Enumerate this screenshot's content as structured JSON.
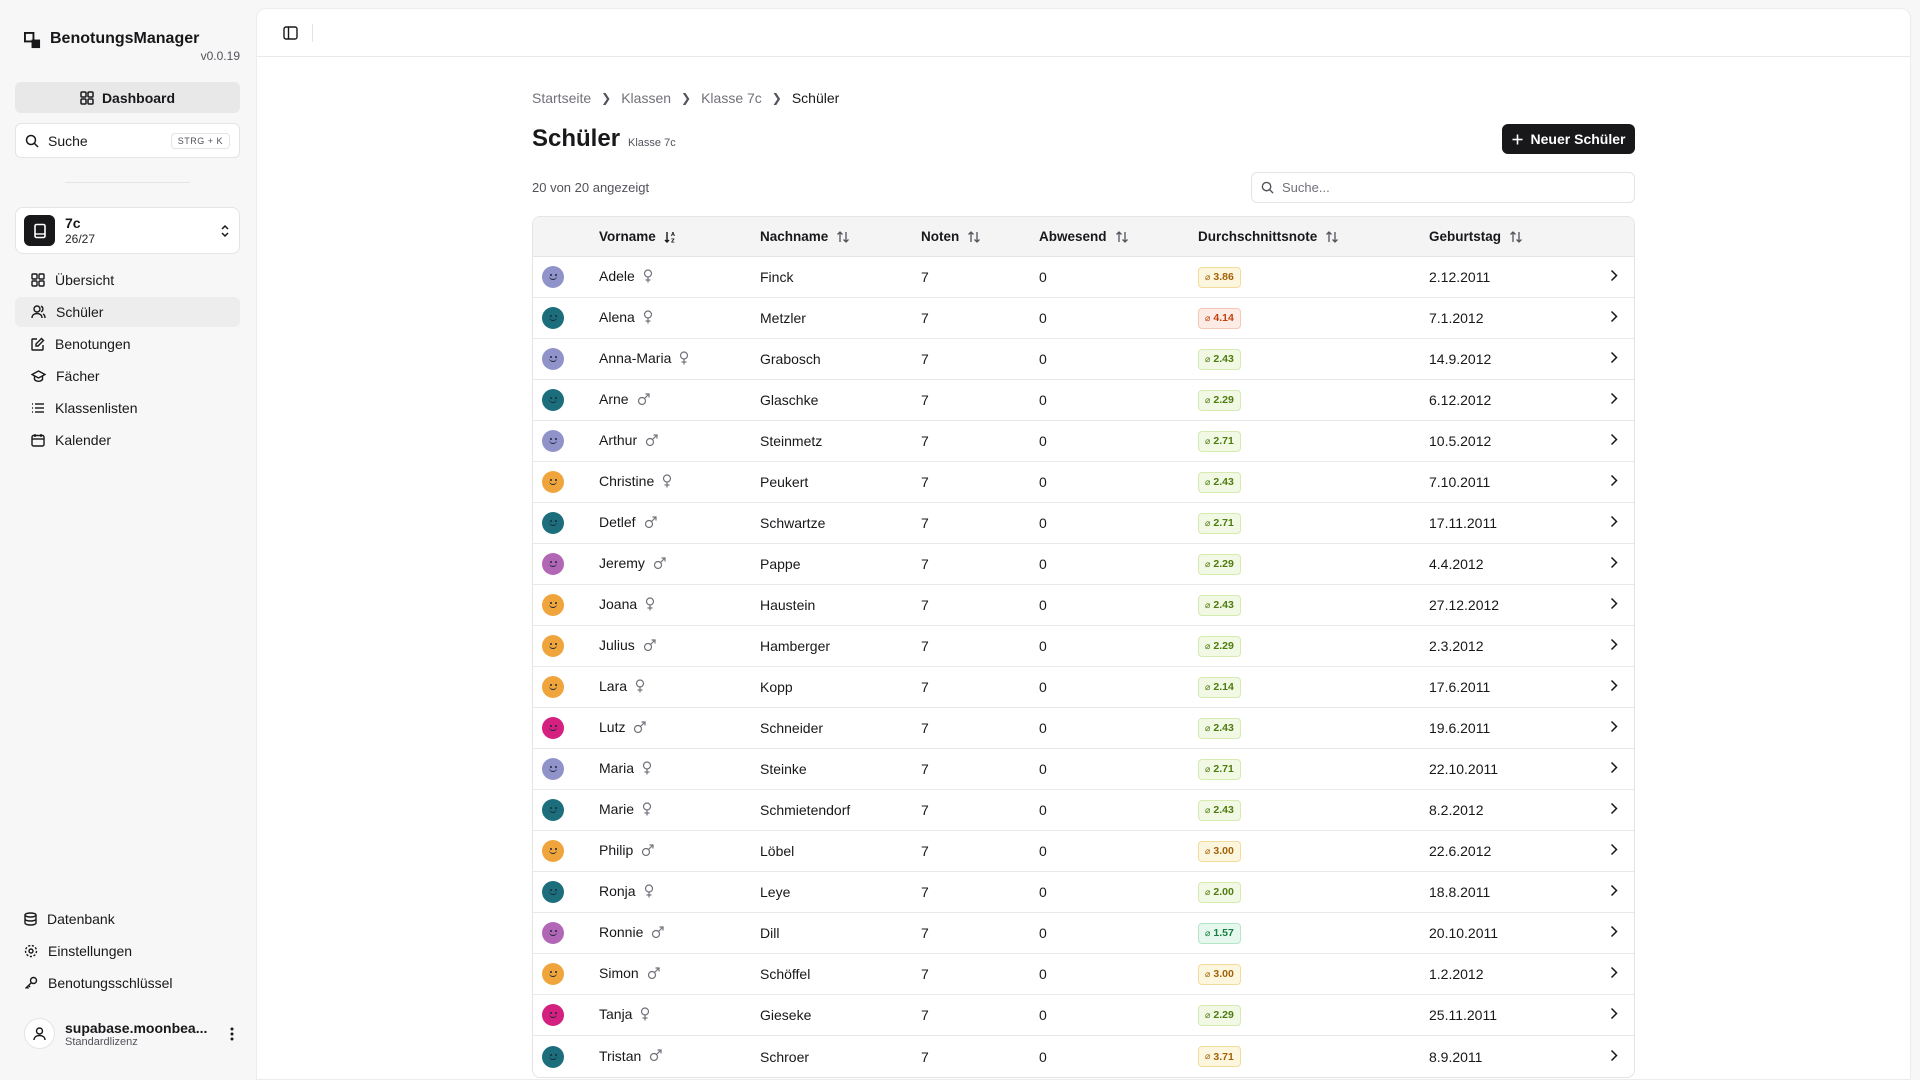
{
  "app": {
    "name": "BenotungsManager",
    "version": "v0.0.19"
  },
  "sidebar": {
    "dashboard_label": "Dashboard",
    "search_label": "Suche",
    "search_shortcut": "STRG + K",
    "class_selector": {
      "name": "7c",
      "sub": "26/27"
    },
    "items": [
      {
        "label": "Übersicht",
        "icon": "grid-icon"
      },
      {
        "label": "Schüler",
        "icon": "users-icon"
      },
      {
        "label": "Benotungen",
        "icon": "edit-icon"
      },
      {
        "label": "Fächer",
        "icon": "graduation-cap-icon"
      },
      {
        "label": "Klassenlisten",
        "icon": "list-icon"
      },
      {
        "label": "Kalender",
        "icon": "calendar-icon"
      }
    ],
    "bottom_items": [
      {
        "label": "Datenbank",
        "icon": "database-icon"
      },
      {
        "label": "Einstellungen",
        "icon": "gear-icon"
      },
      {
        "label": "Benotungsschlüssel",
        "icon": "key-icon"
      }
    ],
    "user": {
      "name": "supabase.moonbea...",
      "license": "Standardlizenz"
    }
  },
  "breadcrumb": {
    "items": [
      "Startseite",
      "Klassen",
      "Klasse 7c"
    ],
    "current": "Schüler"
  },
  "page": {
    "title": "Schüler",
    "subtitle": "Klasse 7c",
    "new_button": "Neuer Schüler",
    "count_text": "20 von 20 angezeigt",
    "search_placeholder": "Suche..."
  },
  "table": {
    "columns": [
      "Vorname",
      "Nachname",
      "Noten",
      "Abwesend",
      "Durchschnittsnote",
      "Geburtstag"
    ],
    "rows": [
      {
        "vorname": "Adele",
        "gender": "female",
        "nachname": "Finck",
        "noten": "7",
        "abwesend": "0",
        "avg": "3.86",
        "geburtstag": "2.12.2011",
        "avatar": "#8f93c9"
      },
      {
        "vorname": "Alena",
        "gender": "female",
        "nachname": "Metzler",
        "noten": "7",
        "abwesend": "0",
        "avg": "4.14",
        "geburtstag": "7.1.2012",
        "avatar": "#1d6e7c"
      },
      {
        "vorname": "Anna-Maria",
        "gender": "female",
        "nachname": "Grabosch",
        "noten": "7",
        "abwesend": "0",
        "avg": "2.43",
        "geburtstag": "14.9.2012",
        "avatar": "#8f93c9"
      },
      {
        "vorname": "Arne",
        "gender": "male",
        "nachname": "Glaschke",
        "noten": "7",
        "abwesend": "0",
        "avg": "2.29",
        "geburtstag": "6.12.2012",
        "avatar": "#1d6e7c"
      },
      {
        "vorname": "Arthur",
        "gender": "male",
        "nachname": "Steinmetz",
        "noten": "7",
        "abwesend": "0",
        "avg": "2.71",
        "geburtstag": "10.5.2012",
        "avatar": "#8f93c9"
      },
      {
        "vorname": "Christine",
        "gender": "female",
        "nachname": "Peukert",
        "noten": "7",
        "abwesend": "0",
        "avg": "2.43",
        "geburtstag": "7.10.2011",
        "avatar": "#f0a53c"
      },
      {
        "vorname": "Detlef",
        "gender": "male",
        "nachname": "Schwartze",
        "noten": "7",
        "abwesend": "0",
        "avg": "2.71",
        "geburtstag": "17.11.2011",
        "avatar": "#1d6e7c"
      },
      {
        "vorname": "Jeremy",
        "gender": "male",
        "nachname": "Pappe",
        "noten": "7",
        "abwesend": "0",
        "avg": "2.29",
        "geburtstag": "4.4.2012",
        "avatar": "#b267b6"
      },
      {
        "vorname": "Joana",
        "gender": "female",
        "nachname": "Haustein",
        "noten": "7",
        "abwesend": "0",
        "avg": "2.43",
        "geburtstag": "27.12.2012",
        "avatar": "#f0a53c"
      },
      {
        "vorname": "Julius",
        "gender": "male",
        "nachname": "Hamberger",
        "noten": "7",
        "abwesend": "0",
        "avg": "2.29",
        "geburtstag": "2.3.2012",
        "avatar": "#f0a53c"
      },
      {
        "vorname": "Lara",
        "gender": "female",
        "nachname": "Kopp",
        "noten": "7",
        "abwesend": "0",
        "avg": "2.14",
        "geburtstag": "17.6.2011",
        "avatar": "#f0a53c"
      },
      {
        "vorname": "Lutz",
        "gender": "male",
        "nachname": "Schneider",
        "noten": "7",
        "abwesend": "0",
        "avg": "2.43",
        "geburtstag": "19.6.2011",
        "avatar": "#d4207f"
      },
      {
        "vorname": "Maria",
        "gender": "female",
        "nachname": "Steinke",
        "noten": "7",
        "abwesend": "0",
        "avg": "2.71",
        "geburtstag": "22.10.2011",
        "avatar": "#8f93c9"
      },
      {
        "vorname": "Marie",
        "gender": "female",
        "nachname": "Schmietendorf",
        "noten": "7",
        "abwesend": "0",
        "avg": "2.43",
        "geburtstag": "8.2.2012",
        "avatar": "#1d6e7c"
      },
      {
        "vorname": "Philip",
        "gender": "male",
        "nachname": "Löbel",
        "noten": "7",
        "abwesend": "0",
        "avg": "3.00",
        "geburtstag": "22.6.2012",
        "avatar": "#f0a53c"
      },
      {
        "vorname": "Ronja",
        "gender": "female",
        "nachname": "Leye",
        "noten": "7",
        "abwesend": "0",
        "avg": "2.00",
        "geburtstag": "18.8.2011",
        "avatar": "#1d6e7c"
      },
      {
        "vorname": "Ronnie",
        "gender": "male",
        "nachname": "Dill",
        "noten": "7",
        "abwesend": "0",
        "avg": "1.57",
        "geburtstag": "20.10.2011",
        "avatar": "#b267b6"
      },
      {
        "vorname": "Simon",
        "gender": "male",
        "nachname": "Schöffel",
        "noten": "7",
        "abwesend": "0",
        "avg": "3.00",
        "geburtstag": "1.2.2012",
        "avatar": "#f0a53c"
      },
      {
        "vorname": "Tanja",
        "gender": "female",
        "nachname": "Gieseke",
        "noten": "7",
        "abwesend": "0",
        "avg": "2.29",
        "geburtstag": "25.11.2011",
        "avatar": "#d4207f"
      },
      {
        "vorname": "Tristan",
        "gender": "male",
        "nachname": "Schroer",
        "noten": "7",
        "abwesend": "0",
        "avg": "3.71",
        "geburtstag": "8.9.2011",
        "avatar": "#1d6e7c"
      }
    ]
  },
  "colors": {
    "accent": "#18181b",
    "grade_good_bg": "#f1f8e4",
    "grade_good_border": "#d6ebb0",
    "grade_good_text": "#4d7c0f",
    "grade_best_bg": "#e6f7ee",
    "grade_best_border": "#b6e4c9",
    "grade_best_text": "#15803d",
    "grade_mid_bg": "#fdf6df",
    "grade_mid_border": "#f3dc9a",
    "grade_mid_text": "#a16207",
    "grade_bad_bg": "#fdece6",
    "grade_bad_border": "#f6c7b5",
    "grade_bad_text": "#c2410c"
  }
}
